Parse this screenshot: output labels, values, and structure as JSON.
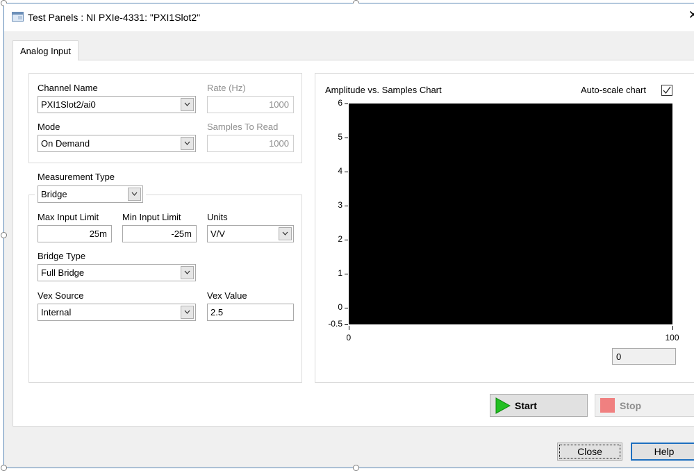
{
  "window": {
    "title": "Test Panels : NI PXIe-4331: \"PXI1Slot2\"",
    "close_glyph": "✕"
  },
  "tabs": [
    {
      "label": "Analog Input",
      "selected": true
    }
  ],
  "channel": {
    "channel_name_label": "Channel Name",
    "channel_name_value": "PXI1Slot2/ai0",
    "rate_label": "Rate (Hz)",
    "rate_value": "1000",
    "mode_label": "Mode",
    "mode_value": "On Demand",
    "samples_label": "Samples To Read",
    "samples_value": "1000"
  },
  "measurement": {
    "type_label": "Measurement Type",
    "type_value": "Bridge",
    "max_label": "Max Input Limit",
    "max_value": "25m",
    "min_label": "Min Input Limit",
    "min_value": "-25m",
    "units_label": "Units",
    "units_value": "V/V",
    "bridge_type_label": "Bridge Type",
    "bridge_type_value": "Full Bridge",
    "vex_source_label": "Vex Source",
    "vex_source_value": "Internal",
    "vex_value_label": "Vex Value",
    "vex_value_value": "2.5"
  },
  "chart": {
    "autoscale_label": "Auto-scale chart",
    "autoscale_checked": true,
    "readout_value": "0",
    "background_color": "#000000"
  },
  "chart_data": {
    "type": "line",
    "title": "Amplitude vs. Samples Chart",
    "xlabel": "",
    "ylabel": "",
    "xlim": [
      0,
      100
    ],
    "ylim": [
      -0.5,
      6
    ],
    "x_ticks": [
      "0",
      "100"
    ],
    "y_ticks": [
      "6",
      "5",
      "4",
      "3",
      "2",
      "1",
      "0",
      "-0.5"
    ],
    "y_tick_values": [
      6,
      5,
      4,
      3,
      2,
      1,
      0,
      -0.5
    ],
    "x_tick_values": [
      0,
      100
    ],
    "series": [],
    "grid": false
  },
  "actions": {
    "start_label": "Start",
    "stop_label": "Stop",
    "start_icon_color": "#22c022",
    "stop_icon_color": "#f08080"
  },
  "dialog": {
    "close_label": "Close",
    "help_label": "Help"
  }
}
